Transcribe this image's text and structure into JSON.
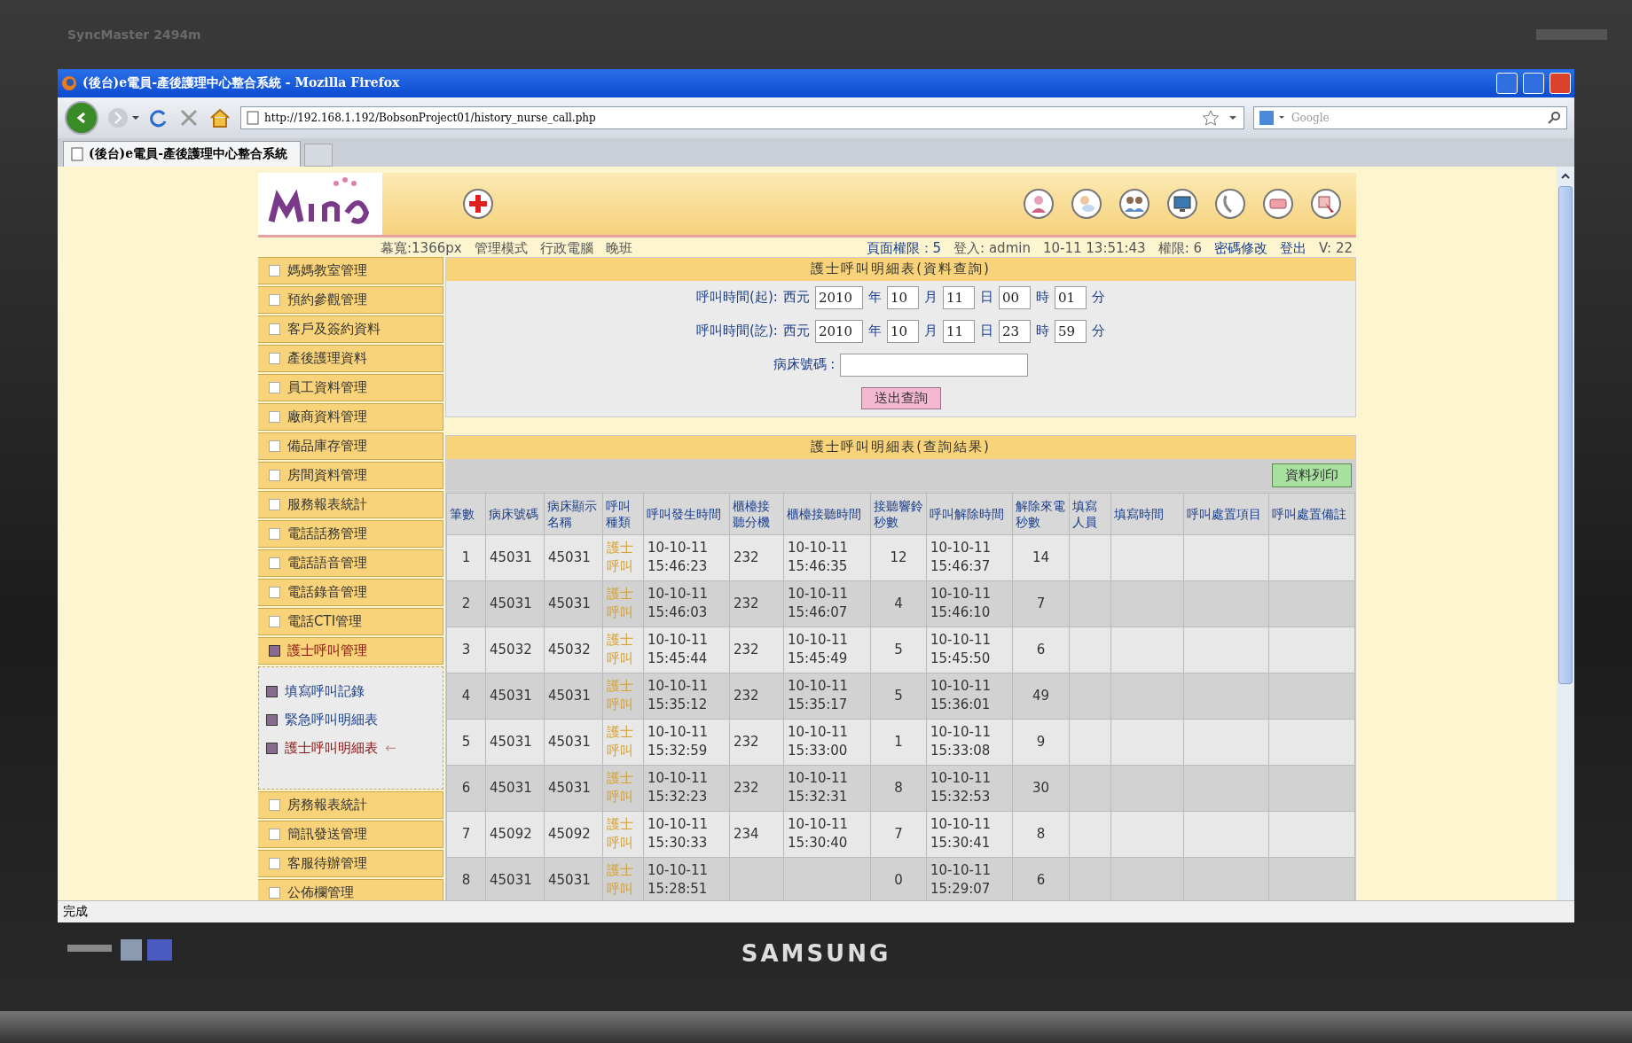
{
  "monitor": {
    "model": "SyncMaster 2494m",
    "brand": "SAMSUNG"
  },
  "window": {
    "title": "(後台)e電員-產後護理中心整合系統 - Mozilla Firefox"
  },
  "toolbar": {
    "url": "http://192.168.1.192/BobsonProject01/history_nurse_call.php",
    "search_placeholder": "Google"
  },
  "tabs": [
    {
      "label": "(後台)e電員-產後護理中心整合系統",
      "selected": true
    }
  ],
  "header": {
    "info_left": [
      "幕寬:1366px",
      "管理模式",
      "行政電腦",
      "晚班"
    ],
    "info_right": [
      {
        "kind": "label",
        "text": "頁面權限：5"
      },
      {
        "kind": "text",
        "text": "登入: admin"
      },
      {
        "kind": "text",
        "text": "10-11 13:51:43"
      },
      {
        "kind": "text",
        "text": "權限: 6"
      },
      {
        "kind": "link",
        "text": "密碼修改"
      },
      {
        "kind": "link",
        "text": "登出"
      },
      {
        "kind": "text",
        "text": "V: 22"
      }
    ]
  },
  "sidebar": {
    "items": [
      {
        "label": "媽媽教室管理",
        "selected": false
      },
      {
        "label": "預約參觀管理",
        "selected": false
      },
      {
        "label": "客戶及簽約資料",
        "selected": false
      },
      {
        "label": "產後護理資料",
        "selected": false
      },
      {
        "label": "員工資料管理",
        "selected": false
      },
      {
        "label": "廠商資料管理",
        "selected": false
      },
      {
        "label": "備品庫存管理",
        "selected": false
      },
      {
        "label": "房間資料管理",
        "selected": false
      },
      {
        "label": "服務報表統計",
        "selected": false
      },
      {
        "label": "電話話務管理",
        "selected": false
      },
      {
        "label": "電話語音管理",
        "selected": false
      },
      {
        "label": "電話錄音管理",
        "selected": false
      },
      {
        "label": "電話CTI管理",
        "selected": false
      },
      {
        "label": "護士呼叫管理",
        "selected": true,
        "children": [
          {
            "label": "填寫呼叫記錄",
            "selected": false
          },
          {
            "label": "緊急呼叫明細表",
            "selected": false
          },
          {
            "label": "護士呼叫明細表",
            "selected": true,
            "marker": "←"
          }
        ]
      },
      {
        "label": "房務報表統計",
        "selected": false
      },
      {
        "label": "簡訊發送管理",
        "selected": false
      },
      {
        "label": "客服待辦管理",
        "selected": false
      },
      {
        "label": "公佈欄管理",
        "selected": false
      }
    ]
  },
  "query": {
    "title": "護士呼叫明細表(資料查詢)",
    "rows": [
      {
        "label": "呼叫時間(起):",
        "prefix": "西元",
        "fields": [
          {
            "value": "2010",
            "unit": "年"
          },
          {
            "value": "10",
            "unit": "月"
          },
          {
            "value": "11",
            "unit": "日"
          },
          {
            "value": "00",
            "unit": "時"
          },
          {
            "value": "01",
            "unit": "分"
          }
        ]
      },
      {
        "label": "呼叫時間(訖):",
        "prefix": "西元",
        "fields": [
          {
            "value": "2010",
            "unit": "年"
          },
          {
            "value": "10",
            "unit": "月"
          },
          {
            "value": "11",
            "unit": "日"
          },
          {
            "value": "23",
            "unit": "時"
          },
          {
            "value": "59",
            "unit": "分"
          }
        ]
      }
    ],
    "bed_label": "病床號碼 :",
    "submit": "送出查詢"
  },
  "results": {
    "title": "護士呼叫明細表(查詢結果)",
    "print": "資料列印",
    "columns": [
      "筆數",
      "病床號碼",
      "病床顯示名稱",
      "呼叫種類",
      "呼叫發生時間",
      "櫃檯接聽分機",
      "櫃檯接聽時間",
      "接聽響鈴秒數",
      "呼叫解除時間",
      "解除來電秒數",
      "填寫人員",
      "填寫時間",
      "呼叫處置項目",
      "呼叫處置備註"
    ],
    "rows": [
      {
        "no": "1",
        "bed_no": "45031",
        "bed_name": "45031",
        "call_type": "護士呼叫",
        "call_time": "10-10-11 15:46:23",
        "desk_ext": "232",
        "desk_time": "10-10-11 15:46:35",
        "ring_sec": "12",
        "release_time": "10-10-11 15:46:37",
        "release_sec": "14"
      },
      {
        "no": "2",
        "bed_no": "45031",
        "bed_name": "45031",
        "call_type": "護士呼叫",
        "call_time": "10-10-11 15:46:03",
        "desk_ext": "232",
        "desk_time": "10-10-11 15:46:07",
        "ring_sec": "4",
        "release_time": "10-10-11 15:46:10",
        "release_sec": "7"
      },
      {
        "no": "3",
        "bed_no": "45032",
        "bed_name": "45032",
        "call_type": "護士呼叫",
        "call_time": "10-10-11 15:45:44",
        "desk_ext": "232",
        "desk_time": "10-10-11 15:45:49",
        "ring_sec": "5",
        "release_time": "10-10-11 15:45:50",
        "release_sec": "6"
      },
      {
        "no": "4",
        "bed_no": "45031",
        "bed_name": "45031",
        "call_type": "護士呼叫",
        "call_time": "10-10-11 15:35:12",
        "desk_ext": "232",
        "desk_time": "10-10-11 15:35:17",
        "ring_sec": "5",
        "release_time": "10-10-11 15:36:01",
        "release_sec": "49"
      },
      {
        "no": "5",
        "bed_no": "45031",
        "bed_name": "45031",
        "call_type": "護士呼叫",
        "call_time": "10-10-11 15:32:59",
        "desk_ext": "232",
        "desk_time": "10-10-11 15:33:00",
        "ring_sec": "1",
        "release_time": "10-10-11 15:33:08",
        "release_sec": "9"
      },
      {
        "no": "6",
        "bed_no": "45031",
        "bed_name": "45031",
        "call_type": "護士呼叫",
        "call_time": "10-10-11 15:32:23",
        "desk_ext": "232",
        "desk_time": "10-10-11 15:32:31",
        "ring_sec": "8",
        "release_time": "10-10-11 15:32:53",
        "release_sec": "30"
      },
      {
        "no": "7",
        "bed_no": "45092",
        "bed_name": "45092",
        "call_type": "護士呼叫",
        "call_time": "10-10-11 15:30:33",
        "desk_ext": "234",
        "desk_time": "10-10-11 15:30:40",
        "ring_sec": "7",
        "release_time": "10-10-11 15:30:41",
        "release_sec": "8"
      },
      {
        "no": "8",
        "bed_no": "45031",
        "bed_name": "45031",
        "call_type": "護士呼叫",
        "call_time": "10-10-11 15:28:51",
        "ring_sec": "0",
        "release_time": "10-10-11 15:29:07",
        "release_sec": "6"
      }
    ]
  },
  "status_bar": "完成"
}
